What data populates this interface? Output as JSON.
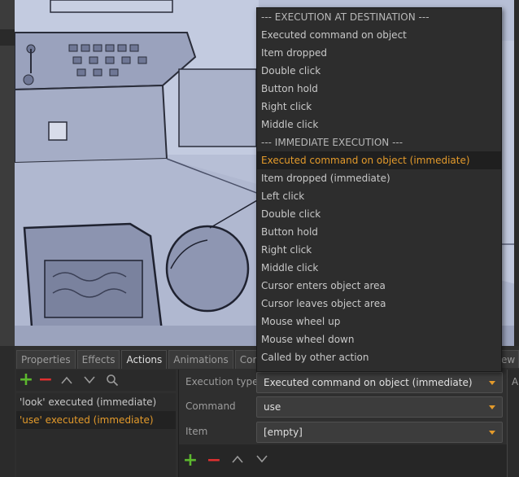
{
  "tabs": [
    "Properties",
    "Effects",
    "Actions",
    "Animations",
    "Condition"
  ],
  "tab_right_partial": "ew",
  "actions_list": [
    "'look' executed (immediate)",
    "'use' executed (immediate)"
  ],
  "props": {
    "execution_type_label": "Execution type",
    "execution_type_value": "Executed command on object (immediate)",
    "command_label": "Command",
    "command_value": "use",
    "item_label": "Item",
    "item_value": "[empty]"
  },
  "side_col_text": "A",
  "dropdown": [
    "--- EXECUTION AT DESTINATION ---",
    "Executed command on object",
    "Item dropped",
    "Double click",
    "Button hold",
    "Right click",
    "Middle click",
    "--- IMMEDIATE EXECUTION ---",
    "Executed command on object (immediate)",
    "Item dropped (immediate)",
    "Left click",
    "Double click",
    "Button hold",
    "Right click",
    "Middle click",
    "Cursor enters object area",
    "Cursor leaves object area",
    "Mouse wheel up",
    "Mouse wheel down",
    "Called by other action"
  ],
  "colors": {
    "accent": "#e39a2b",
    "add_green": "#5cb82e",
    "remove_red": "#e03030"
  }
}
